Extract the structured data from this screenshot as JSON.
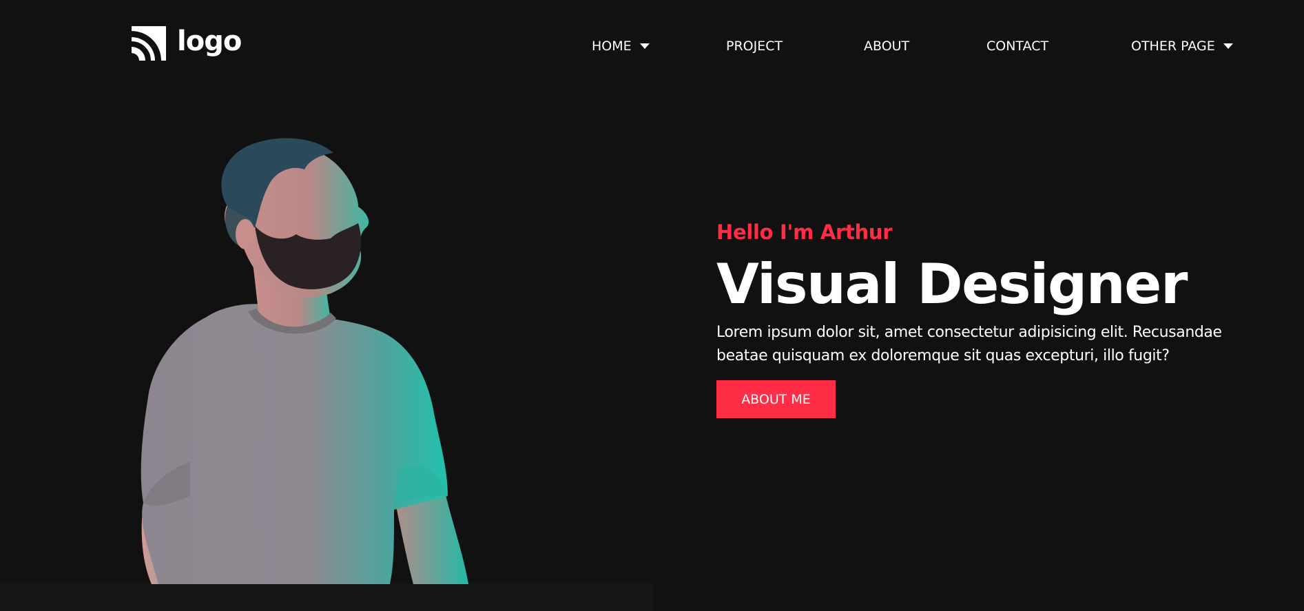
{
  "brand": {
    "logo_text": "logo"
  },
  "nav": {
    "home": "HOME",
    "project": "PROJECT",
    "about": "ABOUT",
    "contact": "CONTACT",
    "other_page": "OTHER PAGE"
  },
  "hero": {
    "greeting": "Hello I'm Arthur",
    "title": "Visual Designer",
    "description": "Lorem ipsum dolor sit, amet consectetur adipisicing elit. Recusandae beatae quisquam ex doloremque sit quas excepturi, illo fugit?",
    "cta_label": "ABOUT ME"
  },
  "colors": {
    "background": "#111111",
    "accent": "#ff2d45",
    "text": "#ffffff",
    "bottom_strip": "#171717"
  },
  "icons": {
    "logo": "signal-arcs-icon",
    "dropdown": "caret-down-icon"
  }
}
